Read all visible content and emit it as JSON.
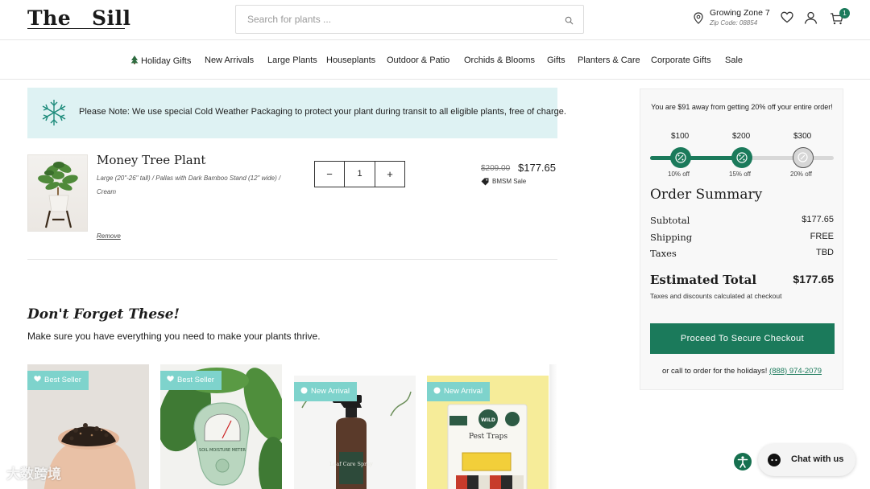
{
  "header": {
    "logo_part1": "The",
    "logo_part2": "Sill",
    "search_placeholder": "Search for plants ...",
    "zone_title": "Growing Zone 7",
    "zone_zip": "Zip Code: 08854",
    "cart_count": "1"
  },
  "nav": {
    "items": [
      "Holiday Gifts",
      "New Arrivals",
      "Large Plants",
      "Houseplants",
      "Outdoor & Patio",
      "Orchids & Blooms",
      "Gifts",
      "Planters & Care",
      "Corporate Gifts",
      "Sale"
    ]
  },
  "notice": {
    "bold": "Please Note:",
    "text": " We use special Cold Weather Packaging to protect your plant during transit to all eligible plants, free of charge."
  },
  "cart_item": {
    "title": "Money Tree Plant",
    "variant": "Large (20\"-26\" tall) / Pallas with Dark Bamboo Stand (12\" wide) / Cream",
    "remove": "Remove",
    "qty_minus": "−",
    "qty_value": "1",
    "qty_plus": "+",
    "old_price": "$209.00",
    "new_price": "$177.65",
    "sale_label": "BMSM Sale"
  },
  "dont_forget": {
    "title": "Don't Forget These!",
    "subtitle": "Make sure you have everything you need to make your plants thrive.",
    "cards": [
      {
        "badge": "Best Seller",
        "badge_icon": "heart-icon"
      },
      {
        "badge": "Best Seller",
        "badge_icon": "heart-icon"
      },
      {
        "badge": "New Arrival",
        "badge_icon": "circle-icon"
      },
      {
        "badge": "New Arrival",
        "badge_icon": "circle-icon"
      }
    ],
    "product_labels": {
      "meter": "SOIL MOISTURE METER",
      "spray": "Leaf Care Spray",
      "wild": "WILD",
      "traps": "Pest Traps"
    }
  },
  "summary": {
    "promo": "You are $91 away from getting 20% off your entire order!",
    "tiers": [
      {
        "amount": "$100",
        "off": "10% off",
        "reached": true
      },
      {
        "amount": "$200",
        "off": "15% off",
        "reached": true
      },
      {
        "amount": "$300",
        "off": "20% off",
        "reached": false
      }
    ],
    "progress_fraction": 0.5,
    "title": "Order Summary",
    "subtotal_label": "Subtotal",
    "subtotal_value": "$177.65",
    "shipping_label": "Shipping",
    "shipping_value": "FREE",
    "taxes_label": "Taxes",
    "taxes_value": "TBD",
    "est_label": "Estimated Total",
    "est_value": "$177.65",
    "est_note": "Taxes and discounts calculated at checkout",
    "checkout_label": "Proceed To Secure Checkout",
    "call_text": "or call to order for the holidays! ",
    "call_phone": "(888) 974-2079"
  },
  "chat": {
    "label": "Chat with us"
  },
  "watermark": "大数跨境",
  "colors": {
    "accent": "#1b7a5b",
    "notice_bg": "#def2f3",
    "badge_bg": "#7ed3cc"
  }
}
